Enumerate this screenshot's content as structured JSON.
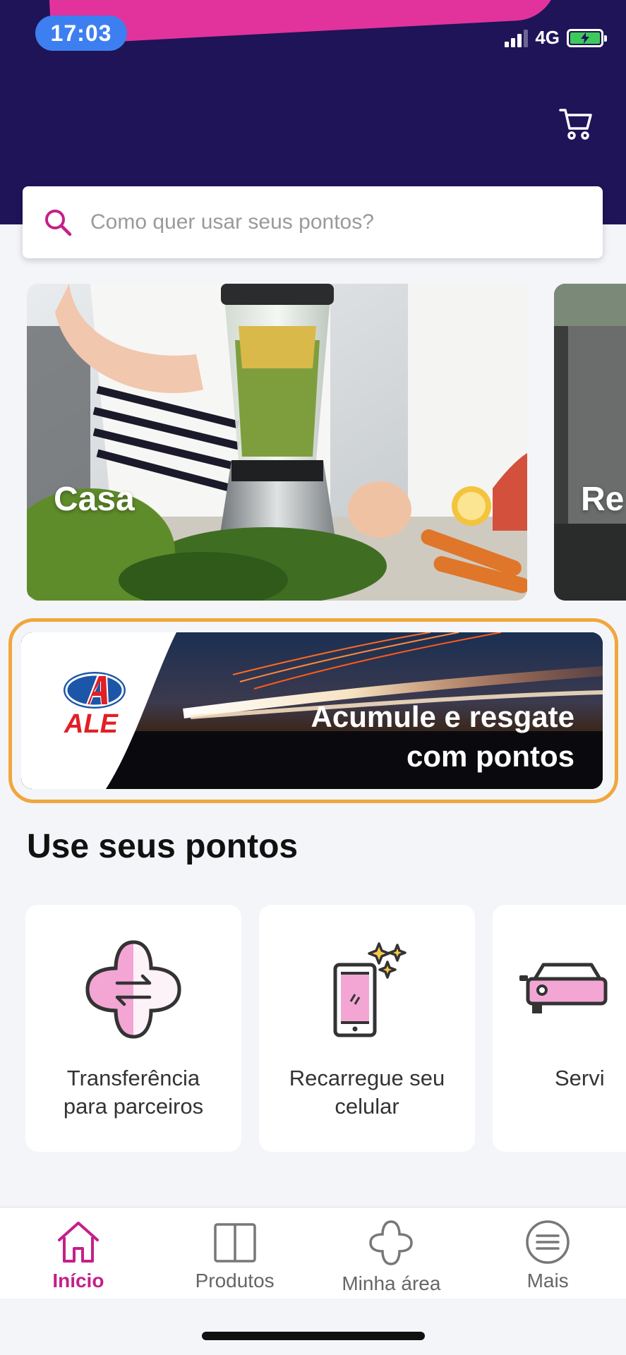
{
  "status_bar": {
    "time": "17:03",
    "network": "4G"
  },
  "header": {
    "cart_icon": "cart-icon"
  },
  "search": {
    "placeholder": "Como quer usar seus pontos?"
  },
  "carousel": {
    "items": [
      {
        "label": "Casa"
      },
      {
        "label": "Re"
      }
    ]
  },
  "banner": {
    "logo_text": "ALE",
    "line1": "Acumule e resgate",
    "line2": "com pontos"
  },
  "section": {
    "title": "Use seus pontos"
  },
  "features": [
    {
      "label": "Transferência\npara parceiros",
      "icon": "transfer-icon"
    },
    {
      "label": "Recarregue seu\ncelular",
      "icon": "phone-recharge-icon"
    },
    {
      "label": "Servi",
      "icon": "car-service-icon"
    }
  ],
  "nav": {
    "items": [
      {
        "label": "Início",
        "icon": "home-icon",
        "active": true
      },
      {
        "label": "Produtos",
        "icon": "book-icon",
        "active": false
      },
      {
        "label": "Minha área",
        "icon": "flower-icon",
        "active": false
      },
      {
        "label": "Mais",
        "icon": "menu-icon",
        "active": false
      }
    ]
  },
  "colors": {
    "header_bg": "#1f1458",
    "accent_pink": "#c3208a",
    "banner_outline": "#f1a63d"
  }
}
